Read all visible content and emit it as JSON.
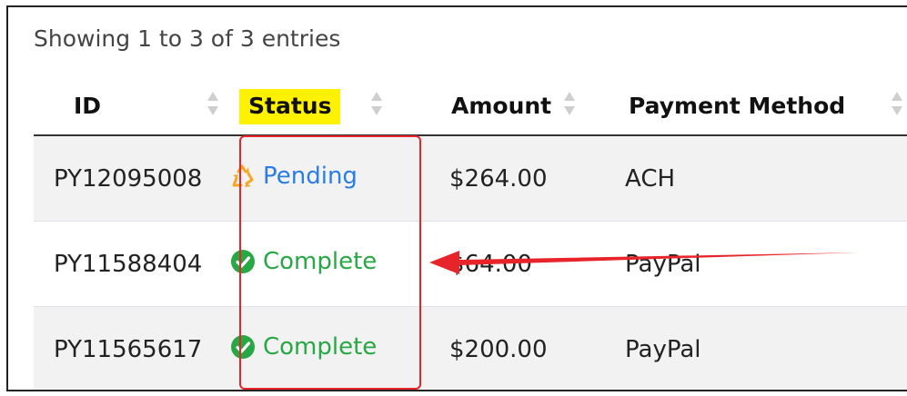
{
  "info_text": "Showing 1 to 3 of 3 entries",
  "columns": [
    "ID",
    "Status",
    "Amount",
    "Payment Method"
  ],
  "rows": [
    {
      "id": "PY12095008",
      "status": "Pending",
      "status_type": "pending",
      "amount": "$264.00",
      "method": "ACH"
    },
    {
      "id": "PY11588404",
      "status": "Complete",
      "status_type": "complete",
      "amount": "$64.00",
      "method": "PayPal"
    },
    {
      "id": "PY11565617",
      "status": "Complete",
      "status_type": "complete",
      "amount": "$200.00",
      "method": "PayPal"
    }
  ],
  "colors": {
    "pending": "#2a7de1",
    "complete": "#28a745",
    "pending_icon": "#f5a623",
    "highlight": "#fff200",
    "annotation": "#e8242b"
  },
  "icons": {
    "pending": "recycle-icon",
    "complete": "check-circle-icon",
    "sort": "sort-icon"
  }
}
